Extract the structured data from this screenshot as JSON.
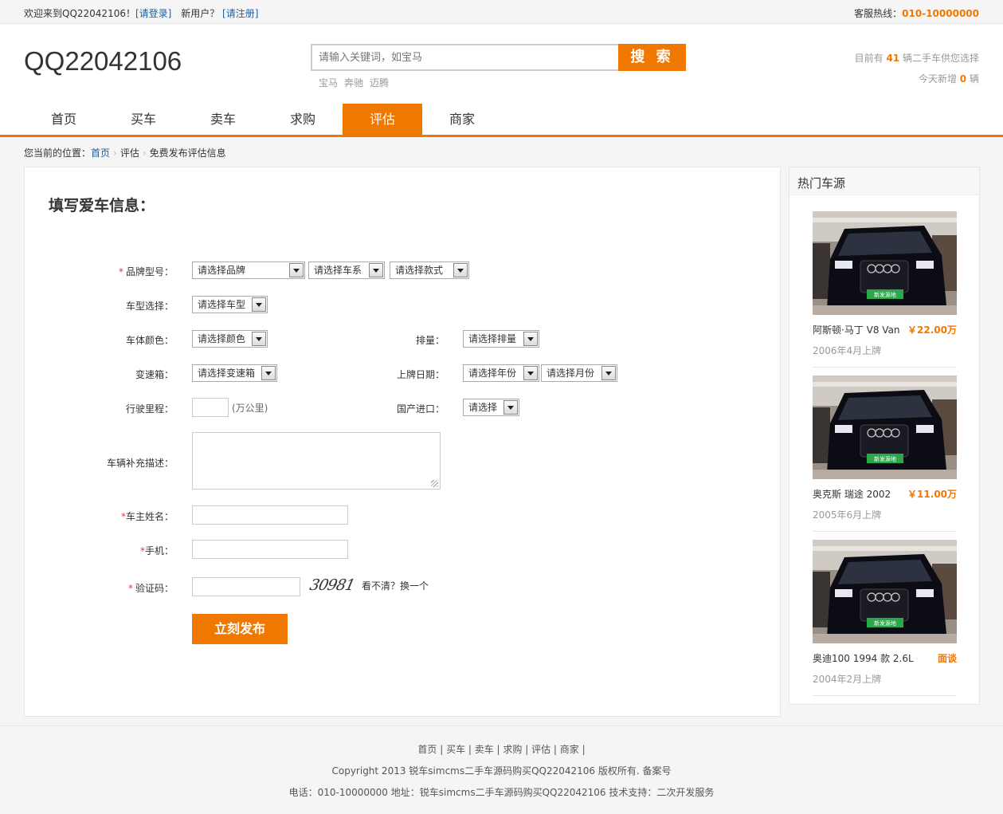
{
  "topbar": {
    "welcome": "欢迎来到QQ22042106！",
    "login": "[请登录]",
    "new_user": "新用户？",
    "register": "[请注册]",
    "hotline_label": "客服热线：",
    "hotline": "010-10000000"
  },
  "header": {
    "logo": "QQ22042106",
    "search_placeholder": "请输入关键词，如宝马",
    "search_button": "搜 索",
    "hotwords": [
      "宝马",
      "奔驰",
      "迈腾"
    ],
    "stats_prefix": "目前有",
    "stats_count": "41",
    "stats_suffix": "辆二手车供您选择",
    "today_prefix": "今天新增",
    "today_count": "0",
    "today_suffix": "辆"
  },
  "nav": {
    "items": [
      "首页",
      "买车",
      "卖车",
      "求购",
      "评估",
      "商家"
    ],
    "active": "评估"
  },
  "breadcrumb": {
    "prefix": "您当前的位置：",
    "home": "首页",
    "level2": "评估",
    "current": "免费发布评估信息"
  },
  "form": {
    "title": "填写爱车信息：",
    "brand_label": "品牌型号：",
    "brand_select": "请选择品牌",
    "series_select": "请选择车系",
    "style_select": "请选择款式",
    "type_label": "车型选择：",
    "type_select": "请选择车型",
    "color_label": "车体颜色：",
    "color_select": "请选择颜色",
    "displacement_label": "排量：",
    "displacement_select": "请选择排量",
    "gearbox_label": "变速箱：",
    "gearbox_select": "请选择变速箱",
    "reg_date_label": "上牌日期：",
    "year_select": "请选择年份",
    "month_select": "请选择月份",
    "mileage_label": "行驶里程：",
    "mileage_value": "",
    "mileage_unit": "(万公里)",
    "origin_label": "国产进口：",
    "origin_select": "请选择",
    "desc_label": "车辆补充描述：",
    "owner_label": "车主姓名：",
    "phone_label": "手机：",
    "captcha_label": "验证码：",
    "captcha_text": "30981",
    "captcha_refresh": "看不清？换一个",
    "required_mark": "*",
    "submit": "立刻发布"
  },
  "sidebar": {
    "title": "热门车源",
    "cars": [
      {
        "name": "阿斯顿·马丁 V8 Van",
        "price": "￥22.00万",
        "date": "2006年4月上牌",
        "plate": "新发源地"
      },
      {
        "name": "奥克斯 瑞途 2002",
        "price": "￥11.00万",
        "date": "2005年6月上牌",
        "plate": "新发源地"
      },
      {
        "name": "奥迪100 1994 款 2.6L",
        "price": "面谈",
        "date": "2004年2月上牌",
        "plate": "新发源地"
      }
    ]
  },
  "footer": {
    "links": "首页 | 买车 | 卖车 | 求购 | 评估 | 商家 |",
    "copyright": "Copyright 2013 锐车simcms二手车源码购买QQ22042106 版权所有. 备案号",
    "contact": "电话：010-10000000 地址：锐车simcms二手车源码购买QQ22042106 技术支持：二次开发服务"
  },
  "colors": {
    "accent": "#f07800",
    "link": "#1a5fa8",
    "required": "#e4393c"
  }
}
